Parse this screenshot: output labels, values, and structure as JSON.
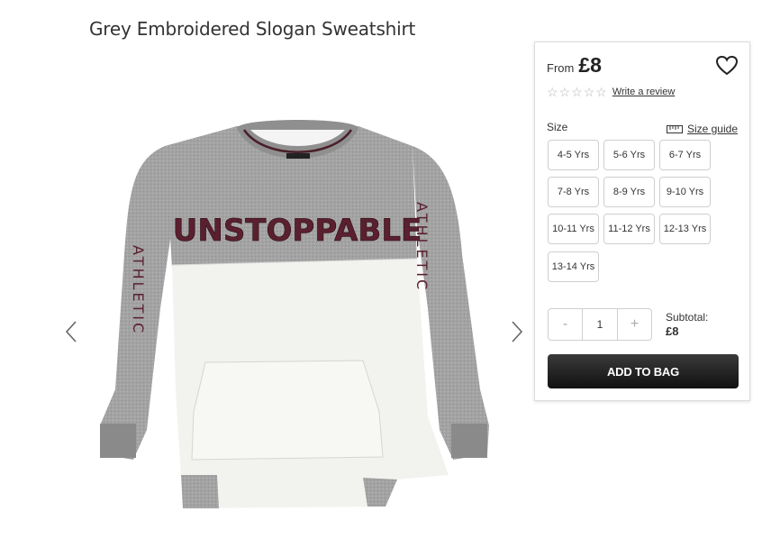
{
  "product": {
    "title": "Grey Embroidered Slogan Sweatshirt",
    "slogan": "UNSTOPPABLE",
    "sleeve_text": "ATHLETIC",
    "image_name": "sweatshirt-image"
  },
  "gallery": {
    "prev_icon": "chevron-left-icon",
    "next_icon": "chevron-right-icon"
  },
  "purchase": {
    "price_prefix": "From",
    "price": "£8",
    "wishlist_icon": "heart-icon",
    "rating_stars": 0,
    "write_review": "Write a review",
    "size_label": "Size",
    "size_guide": "Size guide",
    "sizes": [
      "4-5 Yrs",
      "5-6 Yrs",
      "6-7 Yrs",
      "7-8 Yrs",
      "8-9 Yrs",
      "9-10 Yrs",
      "10-11 Yrs",
      "11-12 Yrs",
      "12-13 Yrs",
      "13-14 Yrs"
    ],
    "qty_minus": "-",
    "qty_value": "1",
    "qty_plus": "+",
    "subtotal_label": "Subtotal:",
    "subtotal_value": "£8",
    "add_to_bag": "ADD TO BAG"
  },
  "colors": {
    "button_dark": "#1a1a1a",
    "border": "#cfcfcf",
    "embroidery": "#5a2030",
    "grey_marl": "#9e9e9e"
  }
}
